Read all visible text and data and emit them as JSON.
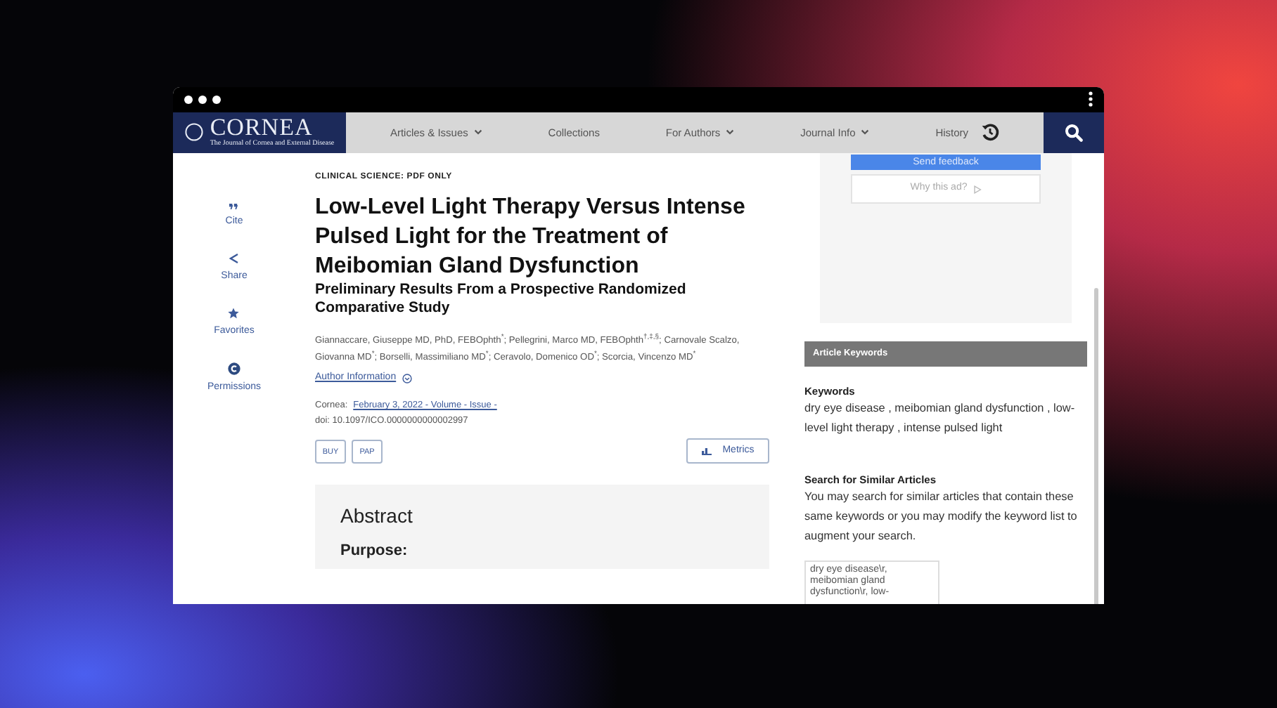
{
  "header": {
    "logo_text": "CORNEA",
    "logo_subtitle": "The Journal of Cornea and External Disease",
    "nav": [
      {
        "label": "Articles & Issues",
        "dropdown": true
      },
      {
        "label": "Collections",
        "dropdown": false
      },
      {
        "label": "For Authors",
        "dropdown": true
      },
      {
        "label": "Journal Info",
        "dropdown": true
      },
      {
        "label": "History",
        "dropdown": false
      }
    ]
  },
  "rail": [
    {
      "label": "Cite"
    },
    {
      "label": "Share"
    },
    {
      "label": "Favorites"
    },
    {
      "label": "Permissions"
    }
  ],
  "article": {
    "section_label": "CLINICAL SCIENCE: PDF ONLY",
    "title": "Low-Level Light Therapy Versus Intense Pulsed Light for the Treatment of Meibomian Gland Dysfunction",
    "subtitle": "Preliminary Results From a Prospective Randomized Comparative Study",
    "authors": "Giannaccare, Giuseppe MD, PhD, FEBOphth$^{*}$; Pellegrini, Marco MD, FEBOphth$^{†,‡,§}$; Carnovale Scalzo, Giovanna MD$^{*}$; Borselli, Massimiliano MD$^{*}$; Ceravolo, Domenico OD$^{*}$; Scorcia, Vincenzo MD$^{*}$",
    "author_info_link": "Author Information",
    "citation": {
      "journal": "Cornea:",
      "issue_link": "February 3, 2022 - Volume - Issue -",
      "doi": "doi: 10.1097/ICO.0000000000002997"
    },
    "buttons": [
      "BUY",
      "PAP"
    ],
    "metrics_button": "Metrics",
    "abstract": {
      "heading": "Abstract",
      "first_section": "Purpose:"
    }
  },
  "sidebar": {
    "ad": {
      "feedback_button": "Send feedback",
      "why_button": "Why this ad?"
    },
    "keywords_panel": {
      "header": "Article Keywords",
      "keywords_heading": "Keywords",
      "keywords": "dry eye disease , meibomian gland dysfunction , low-level light therapy , intense pulsed light",
      "similar_heading": "Search for Similar Articles",
      "similar_text": "You may search for similar articles that contain these same keywords or you may modify the keyword list to augment your search.",
      "search_value": "dry eye disease\\r, meibomian gland dysfunction\\r, low-"
    }
  }
}
